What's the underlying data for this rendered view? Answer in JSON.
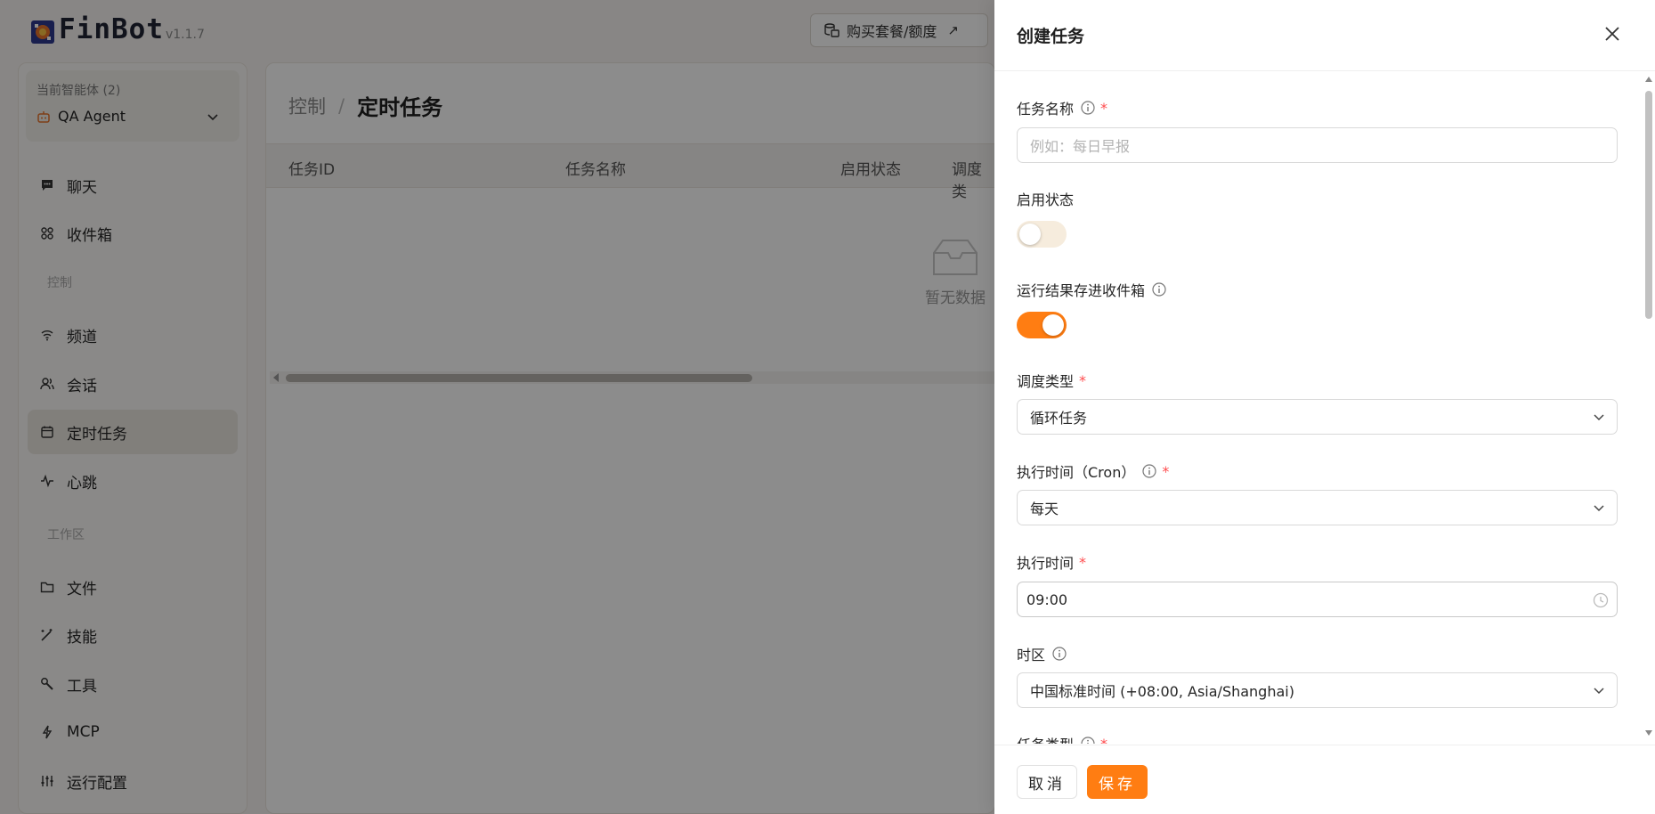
{
  "app": {
    "logo_text": "FinBot",
    "version": "v1.1.7",
    "buy_button": "购买套餐/额度",
    "buy_arrow": "↗"
  },
  "sidebar": {
    "agent_title": "当前智能体 (2)",
    "agent_name": "QA Agent",
    "items": [
      {
        "label": "聊天",
        "icon": "chat-icon"
      },
      {
        "label": "收件箱",
        "icon": "inbox-icon"
      },
      {
        "label": "频道",
        "icon": "wifi-icon"
      },
      {
        "label": "会话",
        "icon": "users-icon"
      },
      {
        "label": "定时任务",
        "icon": "calendar-icon",
        "active": true
      },
      {
        "label": "心跳",
        "icon": "pulse-icon"
      },
      {
        "label": "文件",
        "icon": "folder-icon"
      },
      {
        "label": "技能",
        "icon": "wand-icon"
      },
      {
        "label": "工具",
        "icon": "wrench-icon"
      },
      {
        "label": "MCP",
        "icon": "plug-icon"
      },
      {
        "label": "运行配置",
        "icon": "sliders-icon"
      }
    ],
    "groups": [
      "控制",
      "工作区"
    ]
  },
  "main": {
    "breadcrumb_parent": "控制",
    "breadcrumb_sep": "/",
    "breadcrumb_current": "定时任务",
    "columns": [
      "任务ID",
      "任务名称",
      "启用状态",
      "调度类"
    ],
    "empty_text": "暂无数据"
  },
  "drawer": {
    "title": "创建任务",
    "fields": {
      "task_name_label": "任务名称",
      "task_name_placeholder": "例如：每日早报",
      "enabled_label": "启用状态",
      "enabled": false,
      "save_to_inbox_label": "运行结果存进收件箱",
      "save_to_inbox": true,
      "schedule_type_label": "调度类型",
      "schedule_type_value": "循环任务",
      "cron_label": "执行时间（Cron）",
      "cron_value": "每天",
      "time_label": "执行时间",
      "time_value": "09:00",
      "timezone_label": "时区",
      "timezone_value": "中国标准时间 (+08:00, Asia/Shanghai)",
      "task_type_label": "任务类型"
    },
    "required_mark": "*",
    "cancel_label": "取消",
    "save_label": "保存"
  },
  "colors": {
    "accent": "#ff7d12",
    "required": "#ff4d4f"
  }
}
